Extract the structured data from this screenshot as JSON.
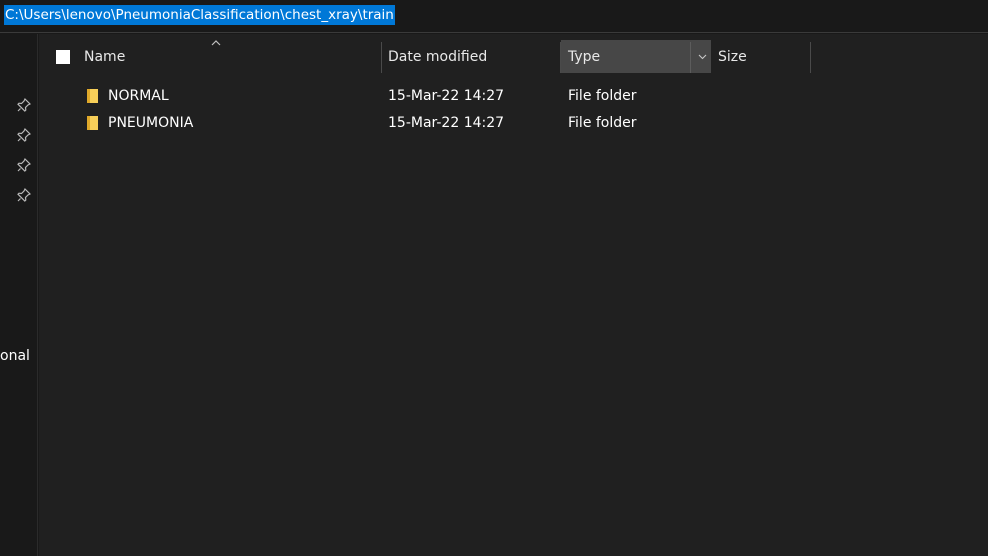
{
  "address": {
    "path": "C:\\Users\\lenovo\\PneumoniaClassification\\chest_xray\\train"
  },
  "nav": {
    "pins": [
      "pin-icon",
      "pin-icon",
      "pin-icon",
      "pin-icon"
    ],
    "partial_label": "onal"
  },
  "columns": {
    "name": "Name",
    "date_modified": "Date modified",
    "type": "Type",
    "size": "Size",
    "sort": "ascending"
  },
  "files": [
    {
      "name": "NORMAL",
      "date_modified": "15-Mar-22 14:27",
      "type": "File folder",
      "size": "",
      "icon": "folder-icon"
    },
    {
      "name": "PNEUMONIA",
      "date_modified": "15-Mar-22 14:27",
      "type": "File folder",
      "size": "",
      "icon": "folder-icon"
    }
  ],
  "colors": {
    "selection": "#0078d7",
    "folder": "#f7cf59",
    "background": "#202020"
  }
}
